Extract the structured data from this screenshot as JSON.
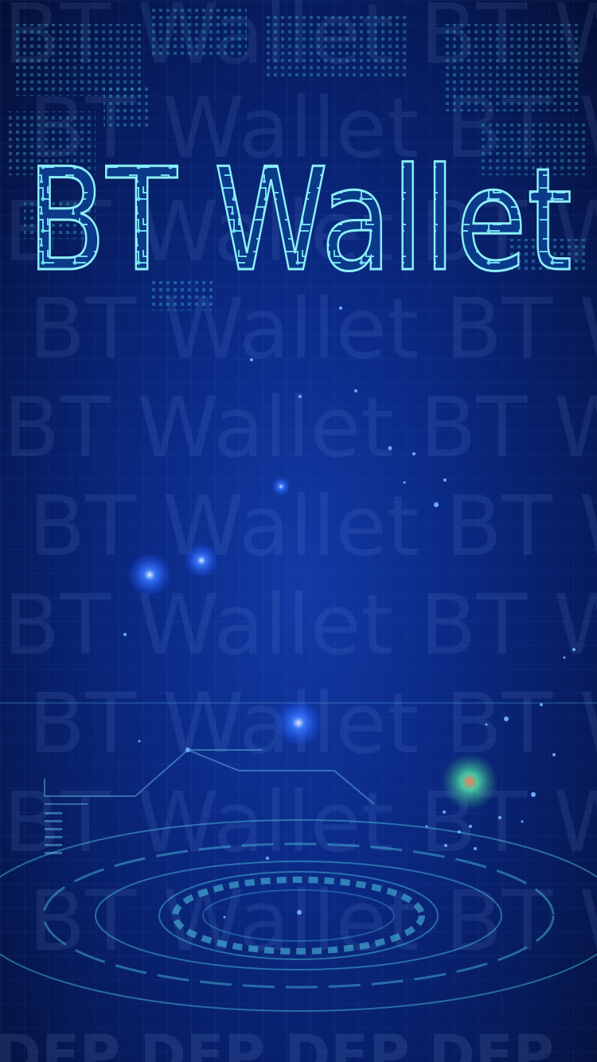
{
  "logo": {
    "text": "BT Wallet"
  },
  "watermark": {
    "text": "BT Wallet  BT Wallet  BT Wallet"
  },
  "bottom_watermark": {
    "text": "DFP DFP DFP DFP"
  },
  "colors": {
    "background_dark": "#050f35",
    "background_mid": "#0b2a86",
    "logo_stroke": "#7fe6f2",
    "glow_blue": "#3a7bff",
    "glow_green": "#4fe0a8"
  }
}
